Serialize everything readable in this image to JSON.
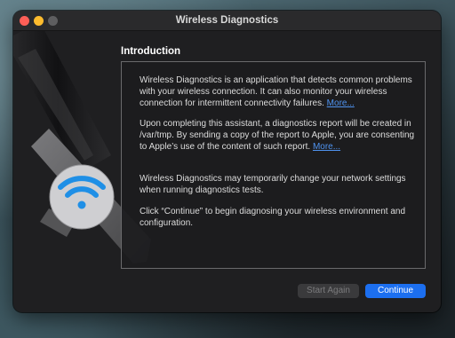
{
  "window": {
    "title": "Wireless Diagnostics"
  },
  "intro": {
    "heading": "Introduction",
    "p1_text": "Wireless Diagnostics is an application that detects common problems with your wireless connection. It can also monitor your wireless connection for intermittent connectivity failures.",
    "p2_text": "Upon completing this assistant, a diagnostics report will be created in /var/tmp. By sending a copy of the report to Apple, you are consenting to Apple’s use of the content of such report.",
    "p3_text": "Wireless Diagnostics may temporarily change your network settings when running diagnostics tests.",
    "p4_text": "Click “Continue” to begin diagnosing your wireless environment and configuration.",
    "more_label": "More..."
  },
  "buttons": {
    "start_again": "Start Again",
    "continue": "Continue"
  },
  "colors": {
    "accent": "#1c6ff0",
    "link": "#4f93f0",
    "wifi_icon": "#1f8fe6",
    "window_bg": "#1f1f21"
  },
  "icons": {
    "app_art": "wrench-wifi-icon"
  }
}
